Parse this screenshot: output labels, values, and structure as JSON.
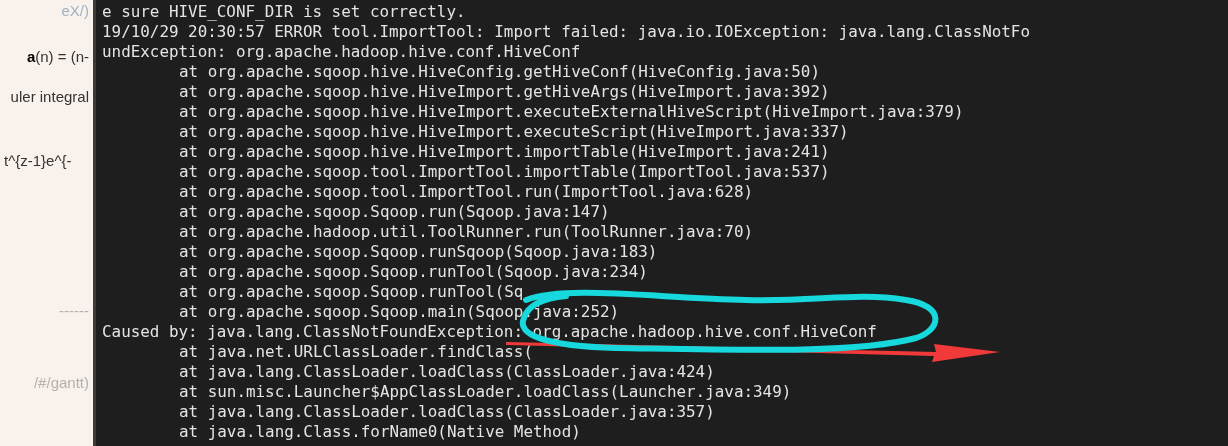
{
  "side_panel": {
    "items": [
      {
        "text": "eX/)",
        "kind": "link"
      },
      {
        "text": "**a**(n) = (n-",
        "kind": "body"
      },
      {
        "text": "uler integral",
        "kind": "body"
      },
      {
        "text": "t^{z-1}e^{-",
        "kind": "body"
      },
      {
        "text": "------",
        "kind": "muted"
      },
      {
        "text": "/#/gantt)",
        "kind": "muted"
      }
    ]
  },
  "terminal": {
    "lines": [
      {
        "text": "e sure HIVE_CONF_DIR is set correctly.",
        "kind": "message"
      },
      {
        "text": "19/10/29 20:30:57 ERROR tool.ImportTool: Import failed: java.io.IOException: java.lang.ClassNotFo",
        "kind": "message"
      },
      {
        "text": "undException: org.apache.hadoop.hive.conf.HiveConf",
        "kind": "message"
      },
      {
        "text": "at org.apache.sqoop.hive.HiveConfig.getHiveConf(HiveConfig.java:50)",
        "kind": "frame"
      },
      {
        "text": "at org.apache.sqoop.hive.HiveImport.getHiveArgs(HiveImport.java:392)",
        "kind": "frame"
      },
      {
        "text": "at org.apache.sqoop.hive.HiveImport.executeExternalHiveScript(HiveImport.java:379)",
        "kind": "frame"
      },
      {
        "text": "at org.apache.sqoop.hive.HiveImport.executeScript(HiveImport.java:337)",
        "kind": "frame"
      },
      {
        "text": "at org.apache.sqoop.hive.HiveImport.importTable(HiveImport.java:241)",
        "kind": "frame"
      },
      {
        "text": "at org.apache.sqoop.tool.ImportTool.importTable(ImportTool.java:537)",
        "kind": "frame"
      },
      {
        "text": "at org.apache.sqoop.tool.ImportTool.run(ImportTool.java:628)",
        "kind": "frame"
      },
      {
        "text": "at org.apache.sqoop.Sqoop.run(Sqoop.java:147)",
        "kind": "frame"
      },
      {
        "text": "at org.apache.hadoop.util.ToolRunner.run(ToolRunner.java:70)",
        "kind": "frame"
      },
      {
        "text": "at org.apache.sqoop.Sqoop.runSqoop(Sqoop.java:183)",
        "kind": "frame"
      },
      {
        "text": "at org.apache.sqoop.Sqoop.runTool(Sqoop.java:234)",
        "kind": "frame"
      },
      {
        "text": "at org.apache.sqoop.Sqoop.runTool(Sq",
        "kind": "frame"
      },
      {
        "text": "at org.apache.sqoop.Sqoop.main(Sqoop.java:252)",
        "kind": "frame"
      },
      {
        "text": "Caused by: java.lang.ClassNotFoundException: org.apache.hadoop.hive.conf.HiveConf",
        "kind": "message"
      },
      {
        "text": "at java.net.URLClassLoader.findClass(",
        "kind": "frame"
      },
      {
        "text": "at java.lang.ClassLoader.loadClass(ClassLoader.java:424)",
        "kind": "frame"
      },
      {
        "text": "at sun.misc.Launcher$AppClassLoader.loadClass(Launcher.java:349)",
        "kind": "frame"
      },
      {
        "text": "at java.lang.ClassLoader.loadClass(ClassLoader.java:357)",
        "kind": "frame"
      },
      {
        "text": "at java.lang.Class.forName0(Native Method)",
        "kind": "frame"
      }
    ]
  }
}
